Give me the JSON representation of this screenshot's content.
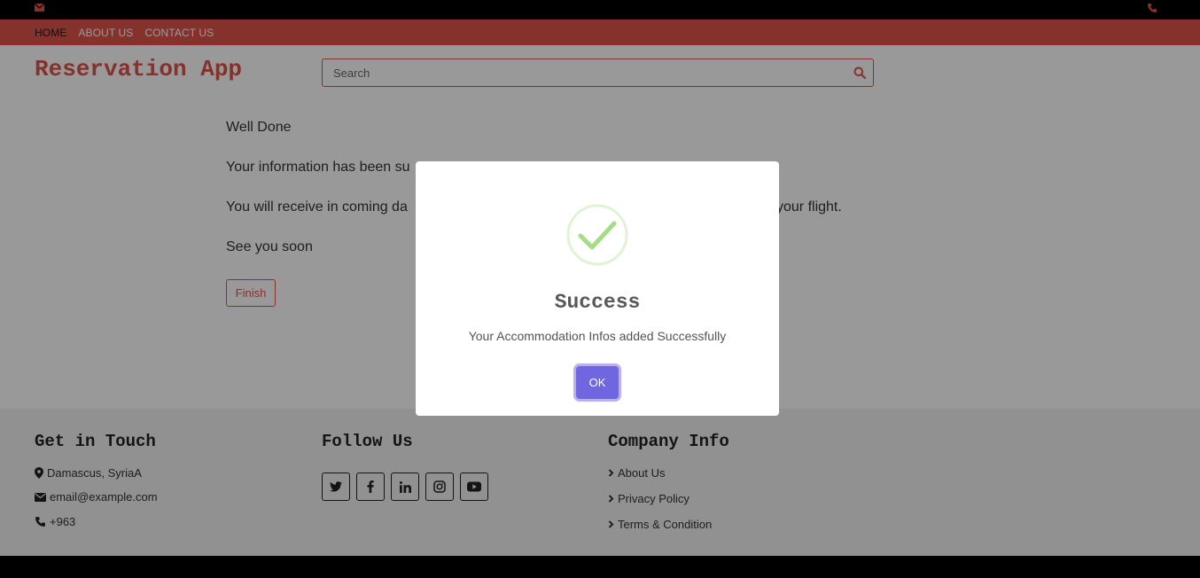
{
  "colors": {
    "accent": "#e0544a",
    "modal_button": "#7066e0",
    "success": "#a5dc86"
  },
  "topbar": {
    "left_icon": "envelope-icon",
    "right_icon": "phone-icon"
  },
  "nav": {
    "items": [
      {
        "label": "HOME"
      },
      {
        "label": "ABOUT US"
      },
      {
        "label": "CONTACT US"
      }
    ]
  },
  "header": {
    "brand": "Reservation App",
    "search_placeholder": "Search",
    "search_icon": "search-icon"
  },
  "main": {
    "line1": "Well Done",
    "line2": "Your information has been su",
    "line3_start": "You will receive in coming da",
    "line3_end": "your flight.",
    "line4": "See you soon",
    "finish_label": "Finish"
  },
  "footer": {
    "touch": {
      "title": "Get in Touch",
      "address": "Damascus, SyriaA",
      "email": "email@example.com",
      "phone": "+963"
    },
    "follow": {
      "title": "Follow Us",
      "icons": [
        "twitter-icon",
        "facebook-icon",
        "linkedin-icon",
        "instagram-icon",
        "youtube-icon"
      ]
    },
    "company": {
      "title": "Company Info",
      "links": [
        "About Us",
        "Privacy Policy",
        "Terms & Condition"
      ]
    }
  },
  "modal": {
    "title": "Success",
    "message": "Your Accommodation Infos added Successfully",
    "ok_label": "OK",
    "icon": "success-check-icon"
  }
}
